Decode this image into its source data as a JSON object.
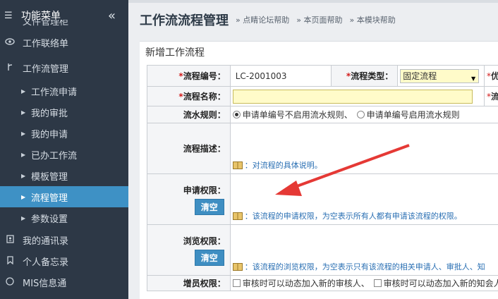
{
  "sidebar": {
    "title": "功能菜单",
    "collapse_icon": "«",
    "cutoff_text": "文件管理柜",
    "top_items": [
      {
        "label": "工作联络单",
        "icon": "eye-icon"
      },
      {
        "label": "工作流管理",
        "icon": "fork-icon"
      }
    ],
    "sub_items": [
      {
        "label": "工作流申请"
      },
      {
        "label": "我的审批"
      },
      {
        "label": "我的申请"
      },
      {
        "label": "已办工作流"
      },
      {
        "label": "模板管理"
      },
      {
        "label": "流程管理",
        "active": true
      },
      {
        "label": "参数设置"
      }
    ],
    "bottom_items": [
      {
        "label": "我的通讯录",
        "icon": "address-book-icon"
      },
      {
        "label": "个人备忘录",
        "icon": "bookmark-icon"
      },
      {
        "label": "MIS信息通",
        "icon": "info-icon"
      }
    ]
  },
  "header": {
    "title": "工作流流程管理",
    "links": [
      "» 点睛论坛帮助",
      "» 本页面帮助",
      "» 本模块帮助"
    ]
  },
  "panel": {
    "title": "新增工作流程"
  },
  "form": {
    "code_label": "流程编号：",
    "code_value": "LC-2001003",
    "type_label": "流程类型：",
    "type_value": "固定流程",
    "name_label": "流程名称：",
    "name_value": "",
    "serial_label": "流水规则：",
    "serial_opt1": "申请单编号不启用流水规则、",
    "serial_opt2": "申请单编号启用流水规则",
    "desc_label": "流程描述：",
    "desc_hint": "：对流程的具体说明。",
    "apply_label": "申请权限：",
    "apply_clear": "清空",
    "apply_hint": "：该流程的申请权限，为空表示所有人都有申请该流程的权限。",
    "browse_label": "浏览权限：",
    "browse_clear": "清空",
    "browse_hint": "：该流程的浏览权限，为空表示只有该流程的相关申请人、审批人、知",
    "add_label": "增员权限：",
    "add_opt1": "审核时可以动态加入新的审核人、",
    "add_opt2": "审核时可以动态加入新的知会人"
  },
  "colors": {
    "sidebar_bg": "#2d3846",
    "active_bg": "#3e91c5",
    "hint_text": "#2a6fb3",
    "required": "#d21c1c",
    "input_yellow": "#fffbc9",
    "arrow": "#e53935"
  }
}
